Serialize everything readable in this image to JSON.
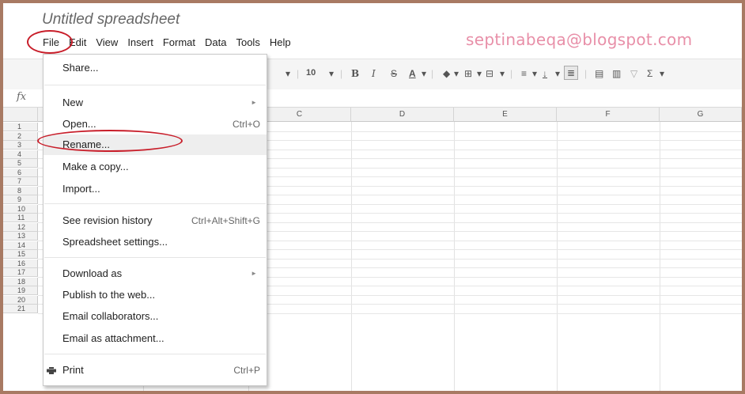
{
  "doc_title": "Untitled spreadsheet",
  "watermark": "septinabeqa@blogspot.com",
  "menubar": [
    "File",
    "Edit",
    "View",
    "Insert",
    "Format",
    "Data",
    "Tools",
    "Help"
  ],
  "toolbar": {
    "font_size": "10",
    "bold": "B",
    "italic": "I",
    "strike": "S",
    "textcolor": "A",
    "sum": "Σ"
  },
  "fx_label": "fx",
  "columns": [
    "C",
    "D",
    "E",
    "F",
    "G"
  ],
  "rows": [
    "1",
    "2",
    "3",
    "4",
    "5",
    "6",
    "7",
    "8",
    "9",
    "10",
    "11",
    "12",
    "13",
    "14",
    "15",
    "16",
    "17",
    "18",
    "19",
    "20",
    "21"
  ],
  "file_menu": {
    "share": "Share...",
    "new": "New",
    "open": "Open...",
    "open_shortcut": "Ctrl+O",
    "rename": "Rename...",
    "copy": "Make a copy...",
    "import": "Import...",
    "revision": "See revision history",
    "revision_shortcut": "Ctrl+Alt+Shift+G",
    "settings": "Spreadsheet settings...",
    "download": "Download as",
    "publish": "Publish to the web...",
    "email_collab": "Email collaborators...",
    "email_attach": "Email as attachment...",
    "print": "Print",
    "print_shortcut": "Ctrl+P"
  },
  "colors": {
    "annotation": "#c81e2a",
    "watermark": "#e88fa8",
    "frame": "#a87a63"
  }
}
